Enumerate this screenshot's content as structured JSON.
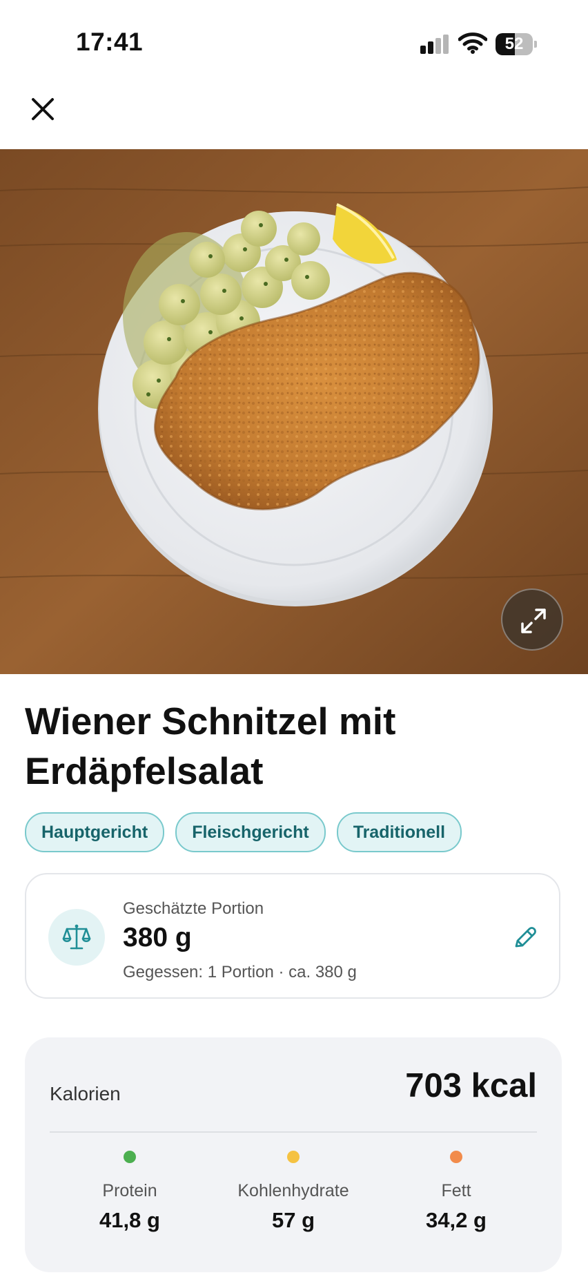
{
  "status_bar": {
    "time": "17:41",
    "battery_percent": "52",
    "battery_level": 0.52
  },
  "dish": {
    "title": "Wiener Schnitzel mit Erdäpfelsalat",
    "tags": [
      "Hauptgericht",
      "Fleischgericht",
      "Traditionell"
    ]
  },
  "portion": {
    "label": "Geschätzte Portion",
    "value": "380 g",
    "detail": "Gegessen: 1 Portion · ca. 380 g"
  },
  "nutrition": {
    "calories_label": "Kalorien",
    "calories_value": "703 kcal",
    "macros": [
      {
        "name": "Protein",
        "value": "41,8 g",
        "color": "#4caf50"
      },
      {
        "name": "Kohlenhydrate",
        "value": "57 g",
        "color": "#f5c242"
      },
      {
        "name": "Fett",
        "value": "34,2 g",
        "color": "#f28b4b"
      }
    ]
  },
  "icons": {
    "close": "close-icon",
    "expand": "expand-icon",
    "scale": "scale-icon",
    "edit": "pencil-icon"
  },
  "colors": {
    "accent": "#1f8e96",
    "tag_bg": "#e2f4f5",
    "card_bg": "#f2f3f6"
  }
}
